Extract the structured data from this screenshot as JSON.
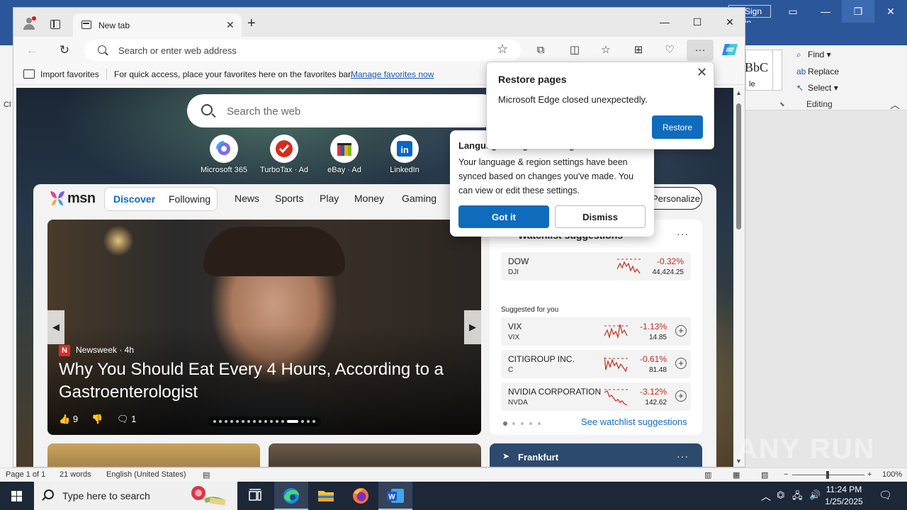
{
  "word": {
    "signin_label": "Sign in",
    "styles_sample": "BbC",
    "styles_label": "le",
    "left_label": "Cl",
    "editing": {
      "find": "Find",
      "replace": "Replace",
      "select": "Select",
      "group_label": "Editing"
    },
    "statusbar": {
      "page": "Page 1 of 1",
      "words": "21 words",
      "language": "English (United States)",
      "zoom": "100%"
    }
  },
  "taskbar": {
    "search_placeholder": "Type here to search",
    "clock_time": "11:24 PM",
    "clock_date": "1/25/2025"
  },
  "edge": {
    "tab_title": "New tab",
    "address_placeholder": "Search or enter web address",
    "favbar": {
      "import_label": "Import favorites",
      "quick_text": "For quick access, place your favorites here on the favorites bar.",
      "manage_link": "Manage favorites now"
    },
    "page": {
      "search_placeholder": "Search the web",
      "quicklinks": [
        {
          "label": "Microsoft 365"
        },
        {
          "label": "TurboTax · Ad"
        },
        {
          "label": "eBay · Ad"
        },
        {
          "label": "LinkedIn"
        }
      ],
      "msn": {
        "logo": "msn",
        "seg_discover": "Discover",
        "seg_following": "Following",
        "nav": [
          "News",
          "Sports",
          "Play",
          "Money",
          "Gaming"
        ],
        "personalize": "Personalize",
        "hero": {
          "source": "Newsweek · 4h",
          "headline": "Why You Should Eat Every 4 Hours, According to a Gastroenterologist",
          "likes": "9",
          "comments": "1"
        },
        "watchlist": {
          "title": "Watchlist suggestions",
          "suggested_label": "Suggested for you",
          "see_link": "See watchlist suggestions",
          "stocks": [
            {
              "name": "DOW",
              "ticker": "DJI",
              "change": "-0.32%",
              "price": "44,424.25"
            },
            {
              "name": "VIX",
              "ticker": "VIX",
              "change": "-1.13%",
              "price": "14.85"
            },
            {
              "name": "CITIGROUP INC.",
              "ticker": "C",
              "change": "-0.61%",
              "price": "81.48"
            },
            {
              "name": "NVIDIA CORPORATION",
              "ticker": "NVDA",
              "change": "-3.12%",
              "price": "142.62"
            }
          ]
        },
        "weather_location": "Frankfurt"
      }
    },
    "restore_popup": {
      "title": "Restore pages",
      "message": "Microsoft Edge closed unexpectedly.",
      "button": "Restore"
    },
    "language_popup": {
      "title": "Language & region settings",
      "message": "Your language & region settings have been synced based on changes you've made. You can view or edit these settings.",
      "got_it": "Got it",
      "dismiss": "Dismiss"
    }
  },
  "watermark": "ANY RUN",
  "colors": {
    "accent": "#0f6cbd",
    "word_blue": "#2b579a",
    "taskbar": "#1c2738",
    "negative": "#c42b1c"
  }
}
